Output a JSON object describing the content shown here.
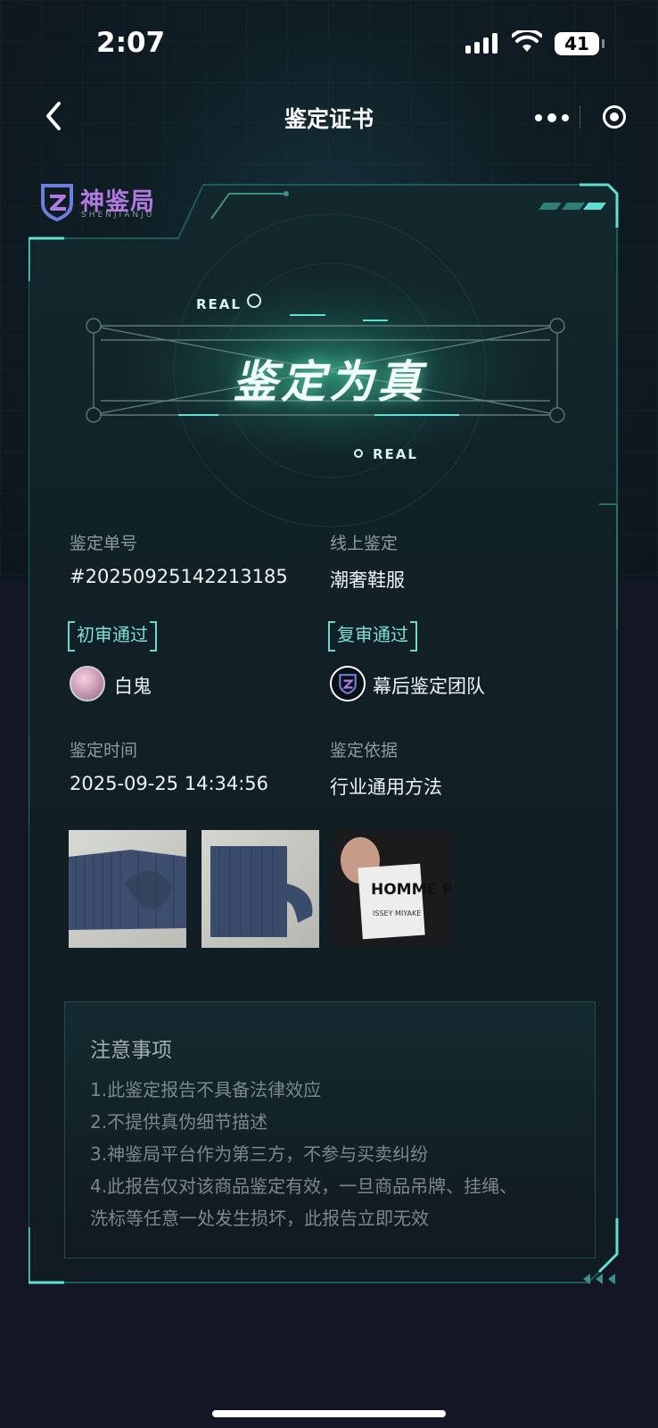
{
  "status_bar": {
    "time": "2:07",
    "battery": "41"
  },
  "nav": {
    "title": "鉴定证书"
  },
  "brand": {
    "name_cn": "神鉴局",
    "name_en": "SHENJIANJU"
  },
  "hero": {
    "tag_top": "REAL",
    "tag_bottom": "REAL",
    "verdict": "鉴定为真"
  },
  "info": {
    "order_label": "鉴定单号",
    "order_value": "#20250925142213185",
    "type_label": "线上鉴定",
    "type_value": "潮奢鞋服",
    "first_review_badge": "初审通过",
    "first_reviewer": "白鬼",
    "second_review_badge": "复审通过",
    "second_reviewer": "幕后鉴定团队",
    "time_label": "鉴定时间",
    "time_value": "2025-09-25 14:34:56",
    "basis_label": "鉴定依据",
    "basis_value": "行业通用方法"
  },
  "photos": {
    "label_brand": "HOMME PLISSÉ",
    "label_sub": "ISSEY MIYAKE"
  },
  "notes": {
    "title": "注意事项",
    "items": [
      "1.此鉴定报告不具备法律效应",
      "2.不提供真伪细节描述",
      "3.神鉴局平台作为第三方，不参与买卖纠纷",
      "4.此报告仅对该商品鉴定有效，一旦商品吊牌、挂绳、",
      "洗标等任意一处发生损坏，此报告立即无效"
    ]
  },
  "colors": {
    "accent": "#5fe0d0",
    "background": "#121521",
    "card": "#132227"
  }
}
